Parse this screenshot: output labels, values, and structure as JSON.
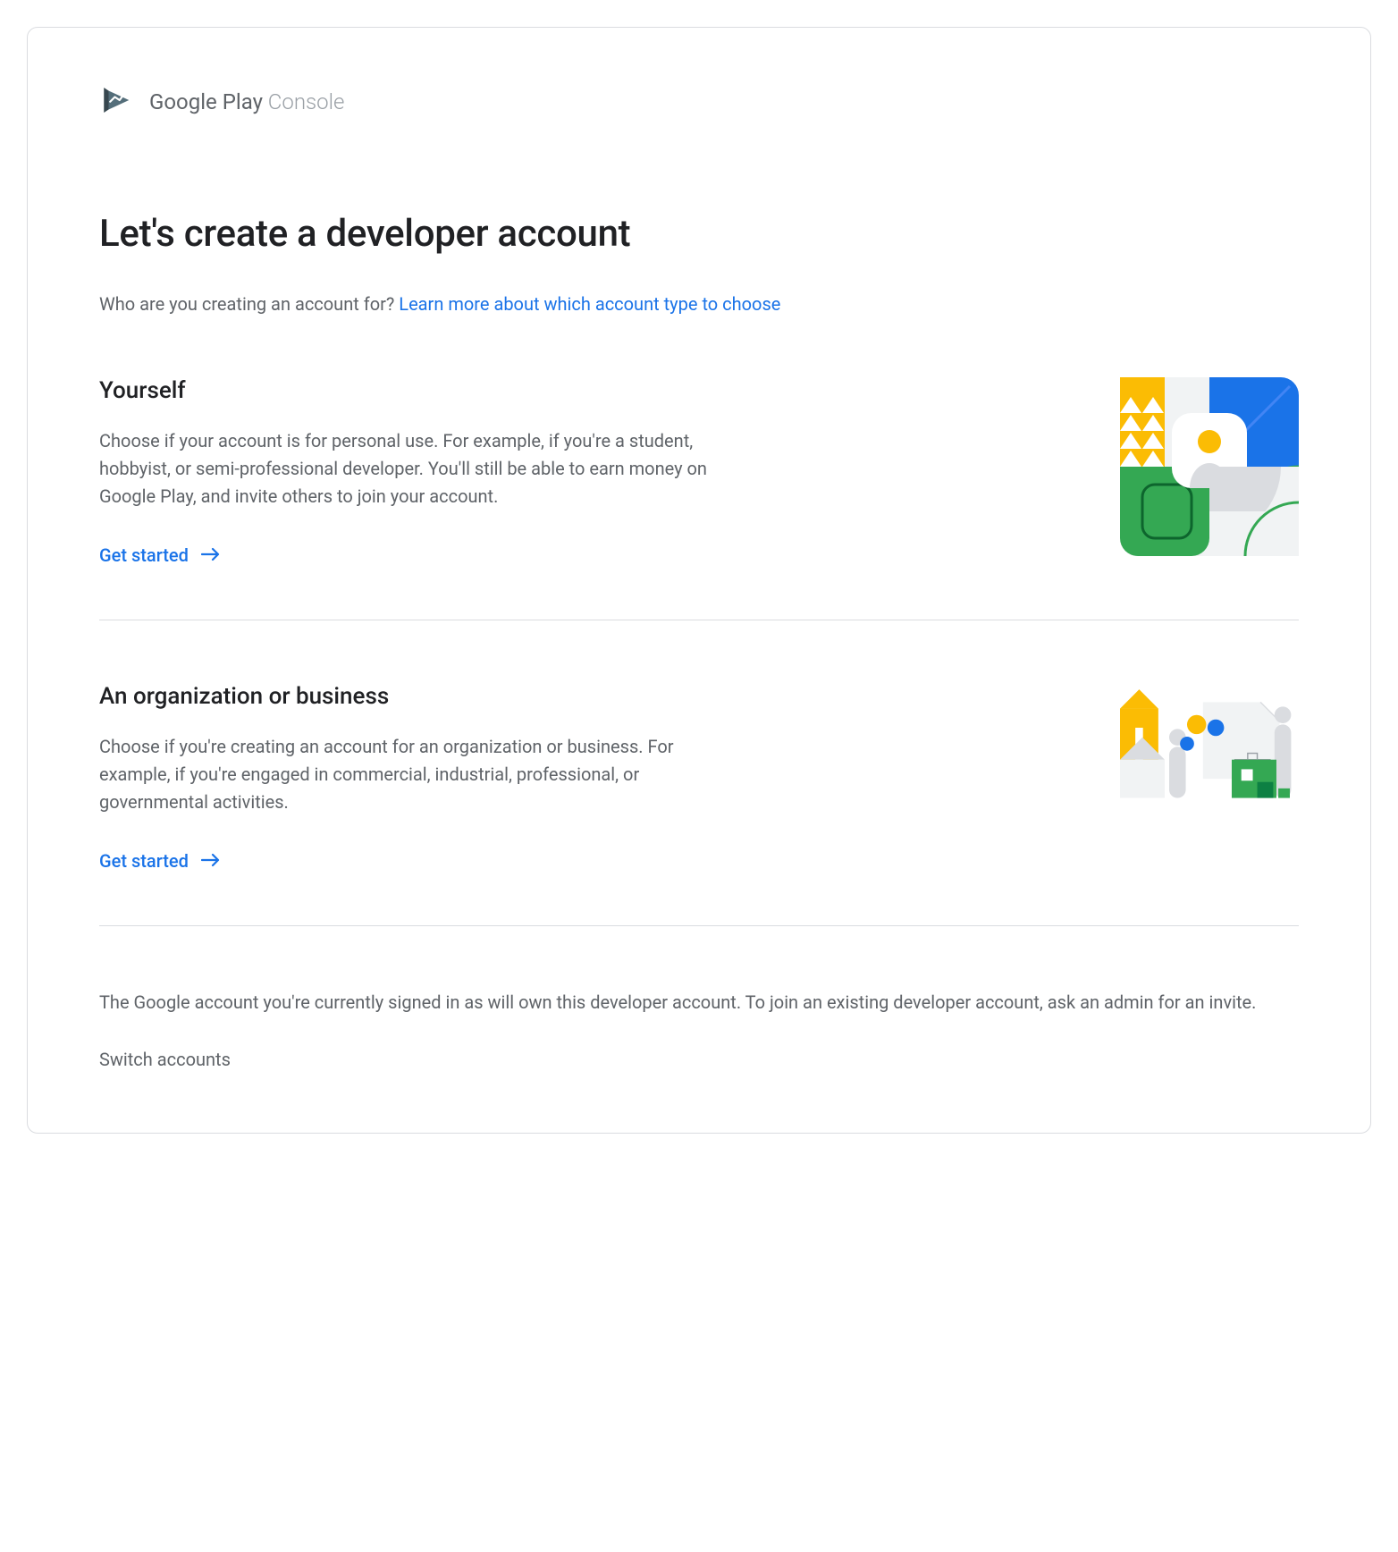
{
  "logo": {
    "text_play": "Google Play",
    "text_console": " Console"
  },
  "page_title": "Let's create a developer account",
  "subtitle": {
    "prefix": "Who are you creating an account for? ",
    "link": "Learn more about which account type to choose"
  },
  "options": {
    "yourself": {
      "title": "Yourself",
      "description": "Choose if your account is for personal use. For example, if you're a student, hobbyist, or semi-professional developer. You'll still be able to earn money on Google Play, and invite others to join your account.",
      "cta": "Get started"
    },
    "organization": {
      "title": "An organization or business",
      "description": "Choose if you're creating an account for an organization or business. For example, if you're engaged in commercial, industrial, professional, or governmental activities.",
      "cta": "Get started"
    }
  },
  "footer": {
    "text": "The Google account you're currently signed in as will own this developer account. To join an existing developer account, ask an admin for an invite.",
    "switch_link": "Switch accounts"
  },
  "colors": {
    "link": "#1a73e8",
    "text_primary": "#202124",
    "text_secondary": "#5f6368",
    "border": "#dadce0",
    "google_blue": "#1a73e8",
    "google_green": "#34a853",
    "google_yellow": "#fbbc04"
  }
}
